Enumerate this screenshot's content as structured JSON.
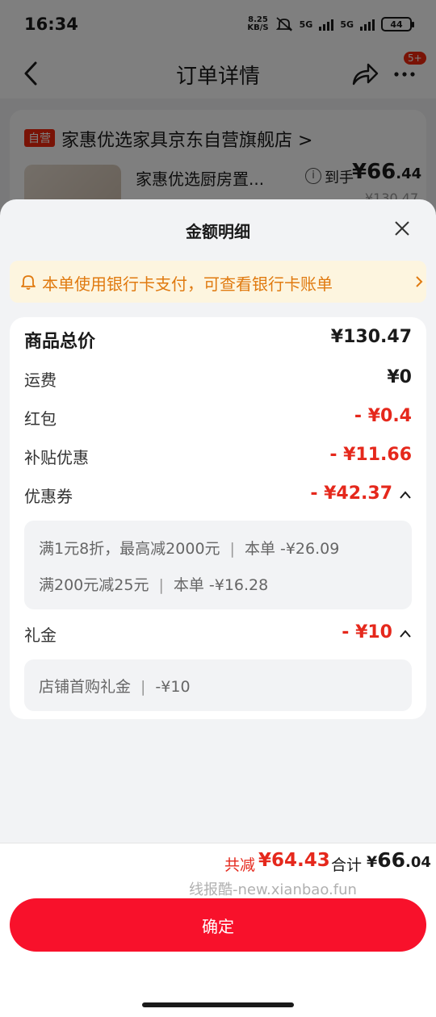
{
  "status_bar": {
    "time": "16:34",
    "net_speed": "8.25",
    "net_unit": "KB/S",
    "signal1_label": "5G",
    "signal2_label": "5G",
    "battery": "44"
  },
  "nav": {
    "title": "订单详情",
    "more_badge": "5+"
  },
  "shop": {
    "self_tag": "自营",
    "name": "家惠优选家具京东自营旗舰店 >",
    "product_name": "家惠优选厨房置...",
    "price_label": "到手",
    "price_main": "¥66",
    "price_decimal": ".44",
    "orig_price": "¥130.47"
  },
  "sheet": {
    "title": "金额明细",
    "notice": "本单使用银行卡支付，可查看银行卡账单",
    "rows": {
      "total": {
        "label": "商品总价",
        "value": "¥130.47"
      },
      "shipping": {
        "label": "运费",
        "value": "¥0"
      },
      "red_packet": {
        "label": "红包",
        "value": "- ¥0.4"
      },
      "subsidy": {
        "label": "补贴优惠",
        "value": "- ¥11.66"
      },
      "coupon": {
        "label": "优惠券",
        "value": "- ¥42.37"
      },
      "gift": {
        "label": "礼金",
        "value": "- ¥10"
      }
    },
    "coupon_details": [
      {
        "rule": "满1元8折，最高减2000元",
        "sep": "|",
        "amount": "本单 -¥26.09"
      },
      {
        "rule": "满200元减25元",
        "sep": "|",
        "amount": "本单 -¥16.28"
      }
    ],
    "gift_details": [
      {
        "rule": "店铺首购礼金",
        "sep": "|",
        "amount": "-¥10"
      }
    ]
  },
  "summary": {
    "reduce_label": "共减",
    "reduce_value": "¥64.43",
    "total_label": "合计",
    "total_currency": "¥",
    "total_main": "66",
    "total_decimal": ".04",
    "watermark": "线报酷-new.xianbao.fun"
  },
  "confirm_label": "确定",
  "colors": {
    "accent_red": "#f8112b",
    "discount_red": "#e5281c",
    "notice_orange": "#e07a10",
    "notice_bg": "#fdf5df"
  }
}
